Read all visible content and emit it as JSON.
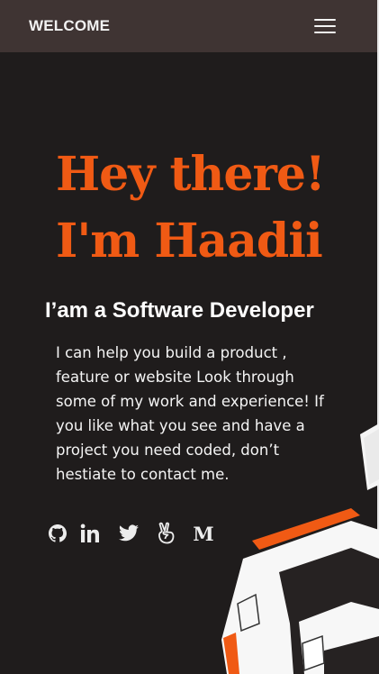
{
  "header": {
    "brand": "WELCOME",
    "menu_icon": "hamburger-menu-icon"
  },
  "hero": {
    "line1": "Hey there!",
    "line2": "I'm Haadii",
    "accent_color": "#f05a14"
  },
  "subtitle": "I’am a Software Developer",
  "bio": "I can help you build a product , feature or website Look through some of my work and experience! If you like what you see and have a project you need coded, don’t hestiate to contact me.",
  "socials": [
    {
      "icon": "github-icon"
    },
    {
      "icon": "linkedin-icon"
    },
    {
      "icon": "twitter-icon"
    },
    {
      "icon": "angellist-icon"
    },
    {
      "icon": "medium-icon",
      "glyph": "M"
    }
  ],
  "colors": {
    "background": "#1f1c1c",
    "topbar": "#3f3433",
    "text": "#f4f4f4"
  }
}
